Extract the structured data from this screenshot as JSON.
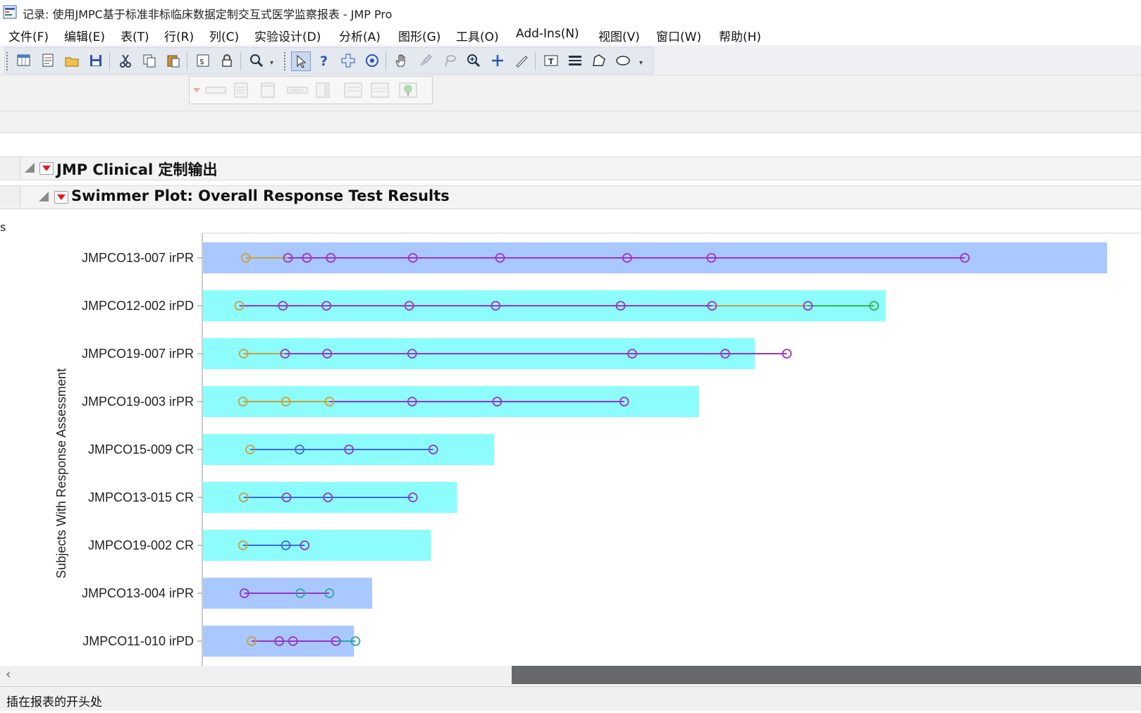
{
  "window": {
    "title": "记录: 使用JMPC基于标准非标临床数据定制交互式医学监察报表 - JMP Pro"
  },
  "menu": [
    {
      "label": "文件(F)",
      "left": 12
    },
    {
      "label": "编辑(E)",
      "left": 91
    },
    {
      "label": "表(T)",
      "left": 171
    },
    {
      "label": "行(R)",
      "left": 233
    },
    {
      "label": "列(C)",
      "left": 297
    },
    {
      "label": "实验设计(D)",
      "left": 361
    },
    {
      "label": "分析(A)",
      "left": 481
    },
    {
      "label": "图形(G)",
      "left": 565
    },
    {
      "label": "工具(O)",
      "left": 647
    },
    {
      "label": "Add-Ins(N)",
      "left": 732
    },
    {
      "label": "视图(V)",
      "left": 849
    },
    {
      "label": "窗口(W)",
      "left": 931
    },
    {
      "label": "帮助(H)",
      "left": 1020
    }
  ],
  "toolbar": {
    "icons": [
      "new-data-table-icon",
      "new-script-icon",
      "open-icon",
      "save-icon",
      "cut-icon",
      "copy-icon",
      "paste-icon",
      "script-editor-icon",
      "lock-icon",
      "search-icon",
      "arrow-select-icon",
      "help-icon",
      "crosshair-icon",
      "target-icon",
      "hand-icon",
      "brush-icon",
      "lasso-icon",
      "zoom-icon",
      "plus-icon",
      "line-tool-icon",
      "text-annotate-icon",
      "lines-icon",
      "polygon-icon",
      "ellipse-icon"
    ]
  },
  "report": {
    "outline1_title": "JMP Clinical 定制输出",
    "outline2_title": "Swimmer Plot: Overall Response Test Results",
    "edge_label": "s"
  },
  "chart_data": {
    "type": "bar",
    "orientation": "horizontal",
    "ylabel": "Subjects With Response Assessment",
    "xlabel": "",
    "xlim": [
      0,
      1250
    ],
    "colors": {
      "bar_blue": "#a9c8ff",
      "bar_cyan": "#8cfcfd",
      "marker_orange": "#c9a13c",
      "marker_purple": "#9b34c9",
      "marker_blue": "#3f6ad3",
      "marker_teal": "#2aa89a",
      "marker_green": "#37b24a"
    },
    "subjects": [
      {
        "label": "JMPCO13-007 irPR",
        "bar": 1245,
        "bar_color": "bar_blue",
        "markers": [
          60,
          118,
          144,
          177,
          290,
          410,
          585,
          701,
          1050
        ],
        "segments": [
          [
            60,
            118,
            "marker_orange"
          ],
          [
            118,
            1050,
            "marker_purple"
          ]
        ],
        "marker_colors": [
          "marker_orange",
          "marker_purple",
          "marker_purple",
          "marker_purple",
          "marker_purple",
          "marker_purple",
          "marker_purple",
          "marker_purple",
          "marker_purple"
        ]
      },
      {
        "label": "JMPCO12-002 irPD",
        "bar": 940,
        "bar_color": "bar_cyan",
        "markers": [
          51,
          111,
          171,
          285,
          404,
          576,
          702,
          834,
          925
        ],
        "segments": [
          [
            51,
            702,
            "marker_purple"
          ],
          [
            702,
            834,
            "marker_orange"
          ],
          [
            834,
            925,
            "marker_green"
          ]
        ],
        "marker_colors": [
          "marker_orange",
          "marker_purple",
          "marker_purple",
          "marker_purple",
          "marker_purple",
          "marker_purple",
          "marker_purple",
          "marker_purple",
          "marker_green"
        ]
      },
      {
        "label": "JMPCO19-007 irPR",
        "bar": 760,
        "bar_color": "bar_cyan",
        "markers": [
          57,
          114,
          172,
          289,
          592,
          720,
          805
        ],
        "segments": [
          [
            57,
            114,
            "marker_orange"
          ],
          [
            114,
            805,
            "marker_purple"
          ]
        ],
        "marker_colors": [
          "marker_orange",
          "marker_purple",
          "marker_purple",
          "marker_purple",
          "marker_purple",
          "marker_purple",
          "marker_purple"
        ]
      },
      {
        "label": "JMPCO19-003 irPR",
        "bar": 683,
        "bar_color": "bar_cyan",
        "markers": [
          56,
          115,
          175,
          289,
          406,
          581
        ],
        "segments": [
          [
            56,
            175,
            "marker_orange"
          ],
          [
            175,
            581,
            "marker_purple"
          ]
        ],
        "marker_colors": [
          "marker_orange",
          "marker_orange",
          "marker_orange",
          "marker_purple",
          "marker_purple",
          "marker_purple"
        ]
      },
      {
        "label": "JMPCO15-009 CR",
        "bar": 401,
        "bar_color": "bar_cyan",
        "markers": [
          66,
          134,
          202,
          318
        ],
        "segments": [
          [
            66,
            318,
            "marker_blue"
          ]
        ],
        "marker_colors": [
          "marker_orange",
          "marker_blue",
          "marker_purple",
          "marker_purple"
        ]
      },
      {
        "label": "JMPCO13-015 CR",
        "bar": 350,
        "bar_color": "bar_cyan",
        "markers": [
          57,
          116,
          173,
          290
        ],
        "segments": [
          [
            57,
            290,
            "marker_blue"
          ]
        ],
        "marker_colors": [
          "marker_orange",
          "marker_purple",
          "marker_purple",
          "marker_purple"
        ]
      },
      {
        "label": "JMPCO19-002 CR",
        "bar": 314,
        "bar_color": "bar_cyan",
        "markers": [
          56,
          115,
          141
        ],
        "segments": [
          [
            56,
            141,
            "marker_blue"
          ]
        ],
        "marker_colors": [
          "marker_orange",
          "marker_blue",
          "marker_purple"
        ]
      },
      {
        "label": "JMPCO13-004 irPR",
        "bar": 233,
        "bar_color": "bar_blue",
        "markers": [
          58,
          135,
          175
        ],
        "segments": [
          [
            58,
            175,
            "marker_purple"
          ]
        ],
        "marker_colors": [
          "marker_purple",
          "marker_teal",
          "marker_teal"
        ]
      },
      {
        "label": "JMPCO11-010 irPD",
        "bar": 208,
        "bar_color": "bar_blue",
        "markers": [
          68,
          106,
          125,
          184,
          211
        ],
        "segments": [
          [
            68,
            184,
            "marker_purple"
          ],
          [
            184,
            211,
            "marker_teal"
          ]
        ],
        "marker_colors": [
          "marker_orange",
          "marker_purple",
          "marker_purple",
          "marker_purple",
          "marker_teal"
        ]
      }
    ]
  },
  "status": {
    "text": "插在报表的开头处"
  }
}
